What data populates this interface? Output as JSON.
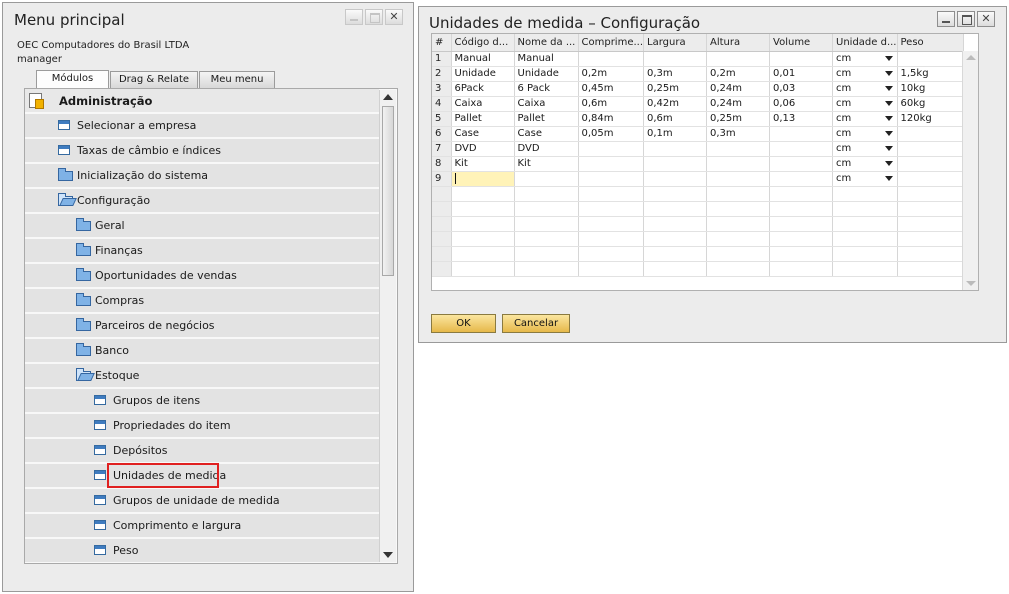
{
  "main_menu": {
    "title": "Menu principal",
    "company": "OEC Computadores do Brasil LTDA",
    "user": "manager",
    "tabs": [
      {
        "label": "Módulos",
        "active": true
      },
      {
        "label": "Drag & Relate",
        "active": false
      },
      {
        "label": "Meu menu",
        "active": false
      }
    ],
    "tree": [
      {
        "label": "Administração",
        "icon": "administration-icon"
      },
      {
        "label": "Selecionar a empresa",
        "icon": "window-icon"
      },
      {
        "label": "Taxas de câmbio e índices",
        "icon": "window-icon"
      },
      {
        "label": "Inicialização do sistema",
        "icon": "folder-icon"
      },
      {
        "label": "Configuração",
        "icon": "folder-open-icon"
      },
      {
        "label": "Geral",
        "icon": "folder-icon"
      },
      {
        "label": "Finanças",
        "icon": "folder-icon"
      },
      {
        "label": "Oportunidades de vendas",
        "icon": "folder-icon"
      },
      {
        "label": "Compras",
        "icon": "folder-icon"
      },
      {
        "label": "Parceiros de negócios",
        "icon": "folder-icon"
      },
      {
        "label": "Banco",
        "icon": "folder-icon"
      },
      {
        "label": "Estoque",
        "icon": "folder-open-icon"
      },
      {
        "label": "Grupos de itens",
        "icon": "window-icon"
      },
      {
        "label": "Propriedades do item",
        "icon": "window-icon"
      },
      {
        "label": "Depósitos",
        "icon": "window-icon"
      },
      {
        "label": "Unidades de medida",
        "icon": "window-icon",
        "highlighted": true
      },
      {
        "label": "Grupos de unidade de medida",
        "icon": "window-icon"
      },
      {
        "label": "Comprimento e largura",
        "icon": "window-icon"
      },
      {
        "label": "Peso",
        "icon": "window-icon"
      }
    ]
  },
  "uom_window": {
    "title": "Unidades de medida – Configuração",
    "columns": [
      "#",
      "Código d...",
      "Nome da ...",
      "Comprime...",
      "Largura",
      "Altura",
      "Volume",
      "Unidade d...",
      "Peso"
    ],
    "rows": [
      [
        "1",
        "Manual",
        "Manual",
        "",
        "",
        "",
        "",
        "cm",
        ""
      ],
      [
        "2",
        "Unidade",
        "Unidade",
        "0,2m",
        "0,3m",
        "0,2m",
        "0,01",
        "cm",
        "1,5kg"
      ],
      [
        "3",
        "6Pack",
        "6 Pack",
        "0,45m",
        "0,25m",
        "0,24m",
        "0,03",
        "cm",
        "10kg"
      ],
      [
        "4",
        "Caixa",
        "Caixa",
        "0,6m",
        "0,42m",
        "0,24m",
        "0,06",
        "cm",
        "60kg"
      ],
      [
        "5",
        "Pallet",
        "Pallet",
        "0,84m",
        "0,6m",
        "0,25m",
        "0,13",
        "cm",
        "120kg"
      ],
      [
        "6",
        "Case",
        "Case",
        "0,05m",
        "0,1m",
        "0,3m",
        "",
        "cm",
        ""
      ],
      [
        "7",
        "DVD",
        "DVD",
        "",
        "",
        "",
        "",
        "cm",
        ""
      ],
      [
        "8",
        "Kit",
        "Kit",
        "",
        "",
        "",
        "",
        "cm",
        ""
      ],
      [
        "9",
        "",
        "",
        "",
        "",
        "",
        "",
        "cm",
        ""
      ]
    ],
    "ok_label": "OK",
    "cancel_label": "Cancelar"
  }
}
